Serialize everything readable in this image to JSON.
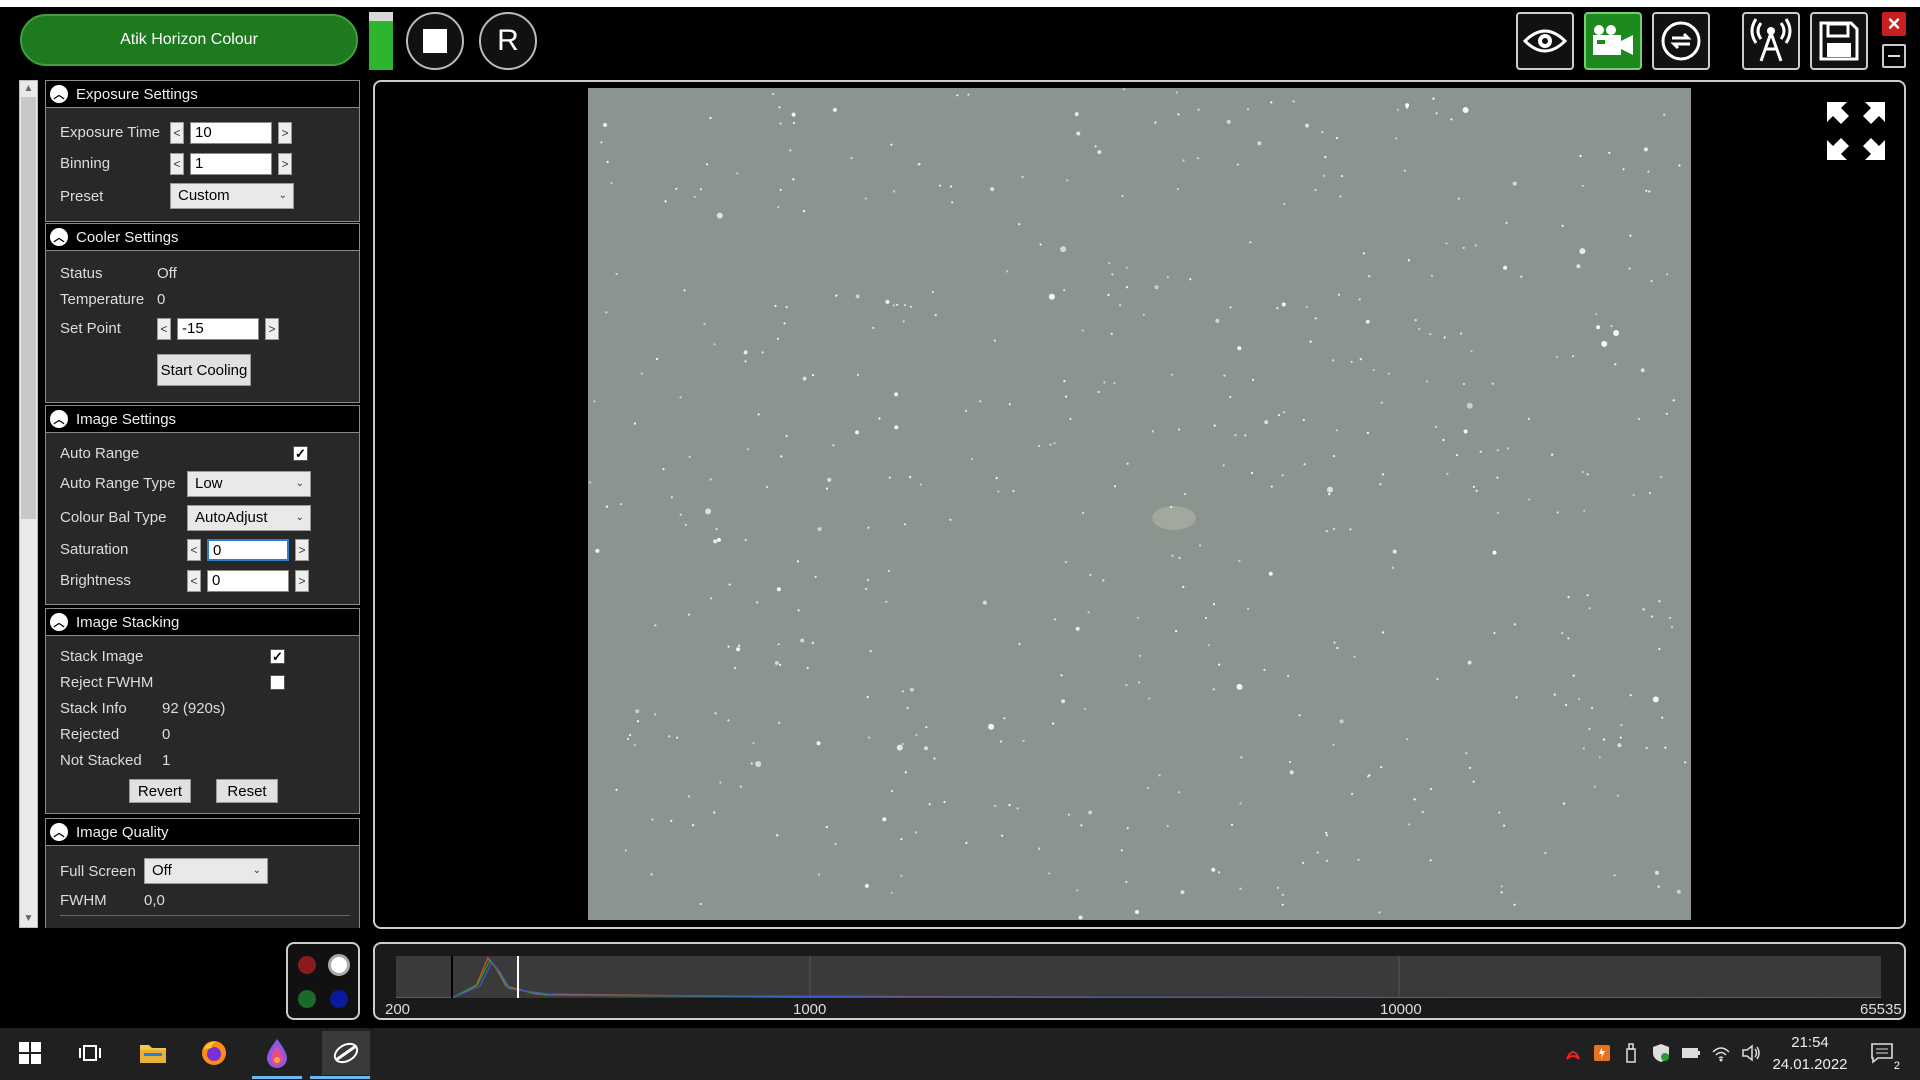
{
  "camera": {
    "name": "Atik Horizon Colour",
    "level_fraction": 0.85
  },
  "controls": {
    "r_label": "R"
  },
  "exposure": {
    "title": "Exposure Settings",
    "exposure_time_label": "Exposure Time",
    "exposure_time_value": "10",
    "binning_label": "Binning",
    "binning_value": "1",
    "preset_label": "Preset",
    "preset_value": "Custom"
  },
  "cooler": {
    "title": "Cooler Settings",
    "status_label": "Status",
    "status_value": "Off",
    "temperature_label": "Temperature",
    "temperature_value": "0",
    "setpoint_label": "Set Point",
    "setpoint_value": "-15",
    "start_button": "Start Cooling"
  },
  "image_settings": {
    "title": "Image Settings",
    "auto_range_label": "Auto Range",
    "auto_range_checked": true,
    "auto_range_type_label": "Auto Range Type",
    "auto_range_type_value": "Low",
    "colour_bal_label": "Colour Bal Type",
    "colour_bal_value": "AutoAdjust",
    "saturation_label": "Saturation",
    "saturation_value": "0",
    "brightness_label": "Brightness",
    "brightness_value": "0"
  },
  "stacking": {
    "title": "Image Stacking",
    "stack_image_label": "Stack Image",
    "stack_image_checked": true,
    "reject_fwhm_label": "Reject FWHM",
    "reject_fwhm_checked": false,
    "stack_info_label": "Stack Info",
    "stack_info_value": "92 (920s)",
    "rejected_label": "Rejected",
    "rejected_value": "0",
    "not_stacked_label": "Not Stacked",
    "not_stacked_value": "1",
    "revert_button": "Revert",
    "reset_button": "Reset"
  },
  "quality": {
    "title": "Image Quality",
    "full_screen_label": "Full Screen",
    "full_screen_value": "Off",
    "fwhm_label": "FWHM",
    "fwhm_value": "0,0"
  },
  "histogram": {
    "labels": [
      "200",
      "1000",
      "10000",
      "65535"
    ]
  },
  "colours": {
    "red": "#8b1a1a",
    "white": "#ffffff",
    "green": "#1a6a2a",
    "blue": "#0a1a9a",
    "accent_green": "#1e7a1e",
    "image_bg": "#8c948f"
  },
  "taskbar": {
    "time": "21:54",
    "date": "24.01.2022",
    "notifications": "2"
  }
}
